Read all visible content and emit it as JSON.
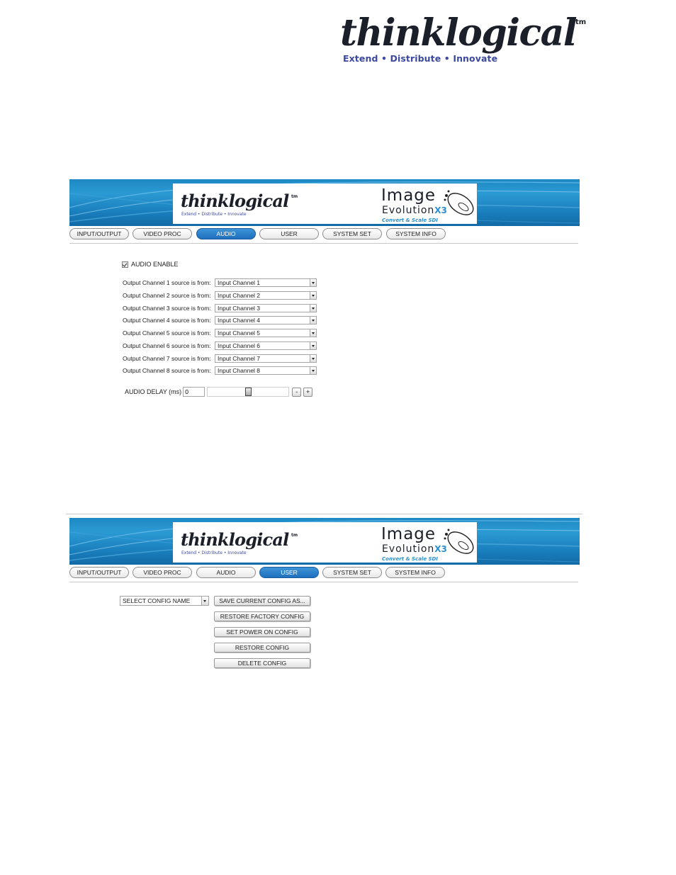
{
  "page_logo": {
    "wordmark": "thinklogical",
    "trademark": "tm",
    "tagline": "Extend • Distribute • Innovate"
  },
  "banner": {
    "brand": "thinklogical",
    "brand_tm": "tm",
    "brand_tagline": "Extend • Distribute • Innovate",
    "product_line1": "Image",
    "product_line2": "Evolution",
    "product_x3": "X3",
    "product_line3": "Convert & Scale SDI"
  },
  "tabs": [
    "INPUT/OUTPUT",
    "VIDEO PROC",
    "AUDIO",
    "USER",
    "SYSTEM SET",
    "SYSTEM INFO"
  ],
  "audio_panel": {
    "active_tab": "AUDIO",
    "audio_enable_label": "AUDIO ENABLE",
    "audio_enabled": true,
    "channels": [
      {
        "label": "Output Channel 1 source is from:",
        "value": "Input Channel 1"
      },
      {
        "label": "Output Channel 2 source is from:",
        "value": "Input Channel 2"
      },
      {
        "label": "Output Channel 3 source is from:",
        "value": "Input Channel 3"
      },
      {
        "label": "Output Channel 4 source is from:",
        "value": "Input Channel 4"
      },
      {
        "label": "Output Channel 5 source is from:",
        "value": "Input Channel 5"
      },
      {
        "label": "Output Channel 6 source is from:",
        "value": "Input Channel 6"
      },
      {
        "label": "Output Channel 7 source is from:",
        "value": "Input Channel 7"
      },
      {
        "label": "Output Channel 8 source is from:",
        "value": "Input Channel 8"
      }
    ],
    "delay_label": "AUDIO DELAY (ms)",
    "delay_value": "0",
    "slider_fraction": 0.5,
    "minus_label": "-",
    "plus_label": "+"
  },
  "user_panel": {
    "active_tab": "USER",
    "config_select_value": "SELECT CONFIG NAME",
    "buttons": [
      "SAVE CURRENT CONFIG AS...",
      "RESTORE FACTORY CONFIG",
      "SET POWER ON CONFIG",
      "RESTORE CONFIG",
      "DELETE CONFIG"
    ]
  },
  "colors": {
    "active_tab": "#2a7fcc",
    "banner_blue": "#1e89c4",
    "brand_tagline": "#3b49a0",
    "product_accent": "#2a8fd0"
  }
}
